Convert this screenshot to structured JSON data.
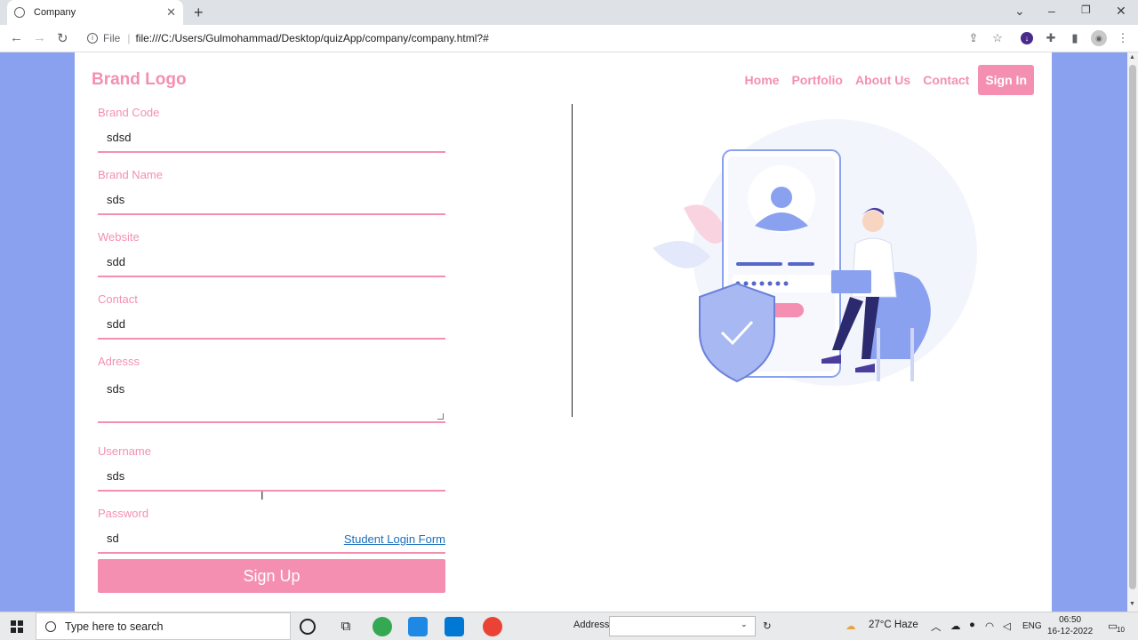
{
  "browser": {
    "tab_title": "Company",
    "url_scheme": "File",
    "url": "file:///C:/Users/Gulmohammad/Desktop/quizApp/company/company.html?#"
  },
  "header": {
    "brand": "Brand Logo",
    "nav": [
      "Home",
      "Portfolio",
      "About Us",
      "Contact"
    ],
    "signin": "Sign In"
  },
  "form": {
    "fields": [
      {
        "label": "Brand Code",
        "value": "sdsd"
      },
      {
        "label": "Brand Name",
        "value": "sds"
      },
      {
        "label": "Website",
        "value": "sdd"
      },
      {
        "label": "Contact",
        "value": "sdd"
      },
      {
        "label": "Adresss",
        "value": "sds"
      },
      {
        "label": "Username",
        "value": "sds"
      },
      {
        "label": "Password",
        "value": "sd"
      }
    ],
    "login_link": "Student Login Form",
    "submit": "Sign Up"
  },
  "colors": {
    "accent": "#f48fb1",
    "page_bg": "#8aa1ef",
    "link": "#1a6fbf"
  },
  "taskbar": {
    "search_placeholder": "Type here to search",
    "address_label": "Address",
    "weather": "27°C  Haze",
    "lang": "ENG",
    "time": "06:50",
    "date": "16-12-2022",
    "notifications": "10"
  }
}
